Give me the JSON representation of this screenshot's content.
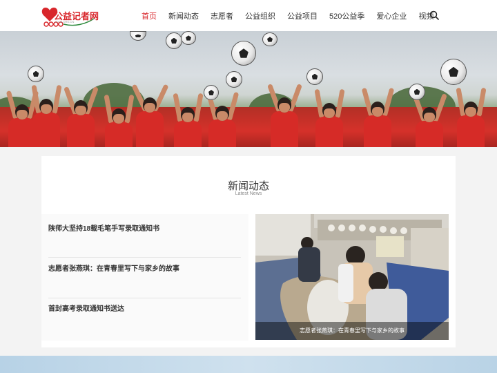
{
  "header": {
    "logo": {
      "text": "公益记者网",
      "sub": "GYJZ.ORG.CN"
    },
    "nav": [
      {
        "label": "首页",
        "active": true
      },
      {
        "label": "新闻动态",
        "active": false
      },
      {
        "label": "志愿者",
        "active": false
      },
      {
        "label": "公益组织",
        "active": false
      },
      {
        "label": "公益项目",
        "active": false
      },
      {
        "label": "520公益季",
        "active": false
      },
      {
        "label": "爱心企业",
        "active": false
      },
      {
        "label": "视频",
        "active": false
      }
    ],
    "search_icon": "search-icon"
  },
  "news": {
    "title": "新闻动态",
    "subtitle": "Latest News",
    "items": [
      "陕师大坚持18载毛笔手写录取通知书",
      "志愿者张燕琪：在青春里写下与家乡的故事",
      "首封高考录取通知书送达"
    ],
    "feature_caption": "志愿者张燕琪：在青春里写下与家乡的故事"
  },
  "colors": {
    "accent": "#d8262b"
  }
}
